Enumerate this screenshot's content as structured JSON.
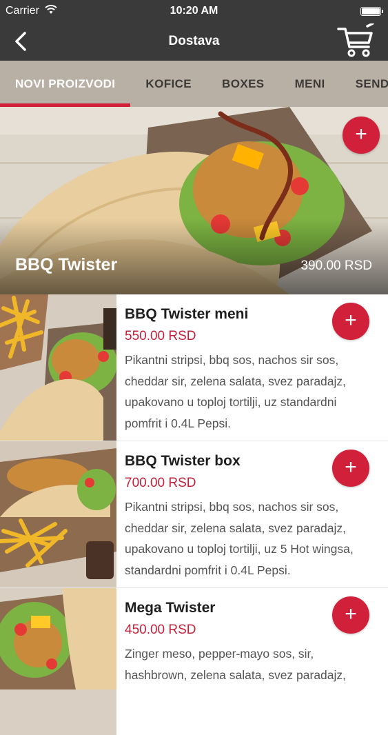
{
  "status_bar": {
    "carrier": "Carrier",
    "time": "10:20 AM",
    "battery_level": 1.0
  },
  "nav": {
    "title": "Dostava",
    "back_icon": "chevron-left-icon",
    "cart_icon": "shopping-cart-icon"
  },
  "tabs": [
    {
      "label": "NOVI PROIZVODI",
      "active": true
    },
    {
      "label": "KOFICE",
      "active": false
    },
    {
      "label": "BOXES",
      "active": false
    },
    {
      "label": "MENI",
      "active": false
    },
    {
      "label": "SENDVIČI",
      "active": false
    }
  ],
  "hero": {
    "title": "BBQ Twister",
    "price": "390.00 RSD",
    "add_label": "+"
  },
  "items": [
    {
      "name": "BBQ Twister meni",
      "price": "550.00 RSD",
      "description": "Pikantni stripsi, bbq sos, nachos sir sos, cheddar sir, zelena salata, svez paradajz, upakovano u toploj tortilji, uz standardni pomfrit i 0.4L Pepsi.",
      "add_label": "+"
    },
    {
      "name": "BBQ Twister box",
      "price": "700.00 RSD",
      "description": "Pikantni stripsi, bbq sos, nachos sir sos, cheddar sir, zelena salata, svez paradajz, upakovano u toploj tortilji, uz 5 Hot wingsa, standardni pomfrit i 0.4L Pepsi.",
      "add_label": "+"
    },
    {
      "name": "Mega Twister",
      "price": "450.00 RSD",
      "description": "Zinger meso, pepper-mayo sos, sir, hashbrown, zelena salata, svez paradajz,",
      "add_label": "+"
    }
  ],
  "colors": {
    "accent": "#d0203a",
    "nav_bg": "#3a3a3a",
    "tab_bg": "#b9b0a5",
    "price": "#c3213b"
  }
}
